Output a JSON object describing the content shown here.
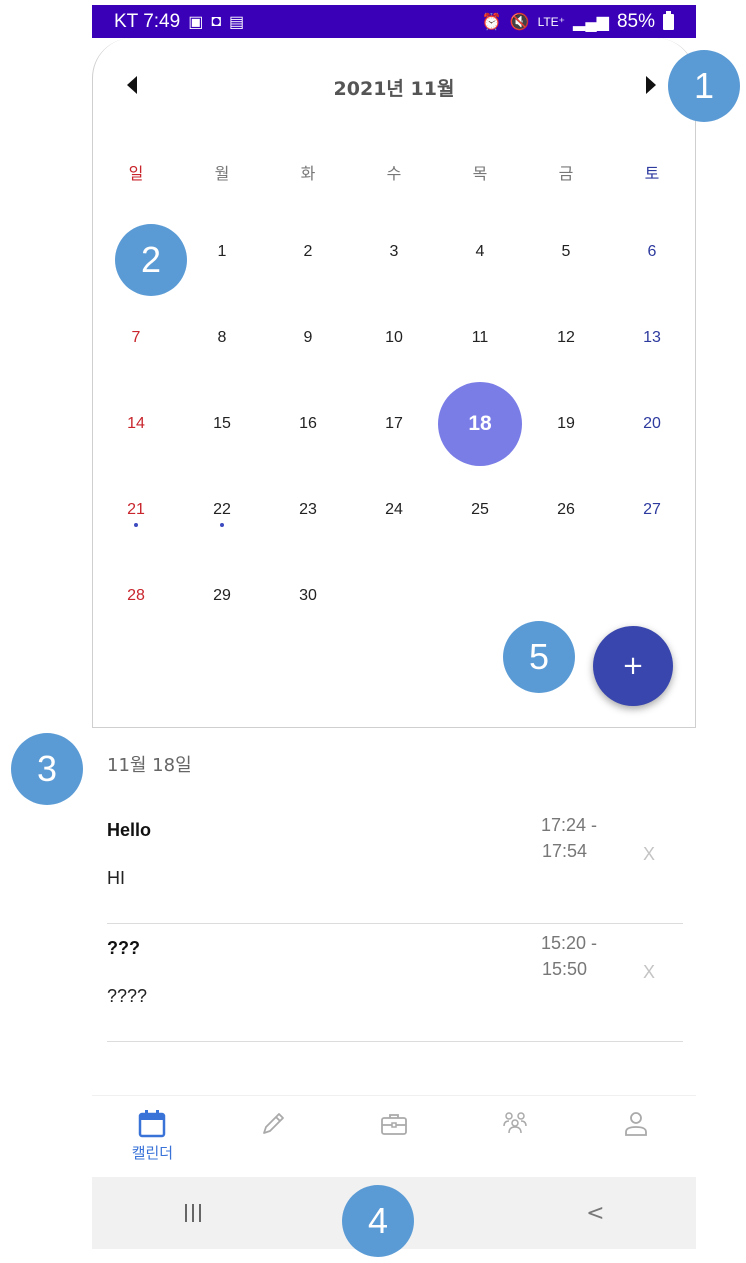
{
  "status_bar": {
    "carrier_time": "KT 7:49",
    "network": "LTE⁺",
    "battery": "85%"
  },
  "calendar": {
    "month_title": "2021년 11월",
    "weekdays": [
      "일",
      "월",
      "화",
      "수",
      "목",
      "금",
      "토"
    ],
    "weeks": [
      [
        "",
        "1",
        "2",
        "3",
        "4",
        "5",
        "6"
      ],
      [
        "7",
        "8",
        "9",
        "10",
        "11",
        "12",
        "13"
      ],
      [
        "14",
        "15",
        "16",
        "17",
        "18",
        "19",
        "20"
      ],
      [
        "21",
        "22",
        "23",
        "24",
        "25",
        "26",
        "27"
      ],
      [
        "28",
        "29",
        "30",
        "",
        "",
        "",
        ""
      ]
    ],
    "selected_day": "18",
    "event_dot_days": [
      "21",
      "22"
    ],
    "fab_label": "+"
  },
  "event_list": {
    "selected_date": "11월 18일",
    "events": [
      {
        "title": "Hello",
        "description": "HI",
        "time_start": "17:24 -",
        "time_end": "17:54",
        "delete_label": "X"
      },
      {
        "title": "???",
        "description": "????",
        "time_start": "15:20 -",
        "time_end": "15:50",
        "delete_label": "X"
      }
    ]
  },
  "bottom_nav": {
    "items": [
      {
        "icon": "calendar-icon",
        "label": "캘린더",
        "active": true
      },
      {
        "icon": "pencil-icon",
        "label": ""
      },
      {
        "icon": "briefcase-icon",
        "label": ""
      },
      {
        "icon": "group-icon",
        "label": ""
      },
      {
        "icon": "person-icon",
        "label": ""
      }
    ]
  },
  "system_nav": {
    "back_label": "<"
  },
  "markers": [
    "1",
    "2",
    "3",
    "4",
    "5"
  ],
  "colors": {
    "status_bar": "#3a00b8",
    "sunday": "#c8252c",
    "saturday": "#2d3a9e",
    "selected_day": "#7a7de6",
    "fab": "#3946ad",
    "active_nav": "#3a73d8",
    "marker": "#5b9bd5"
  }
}
